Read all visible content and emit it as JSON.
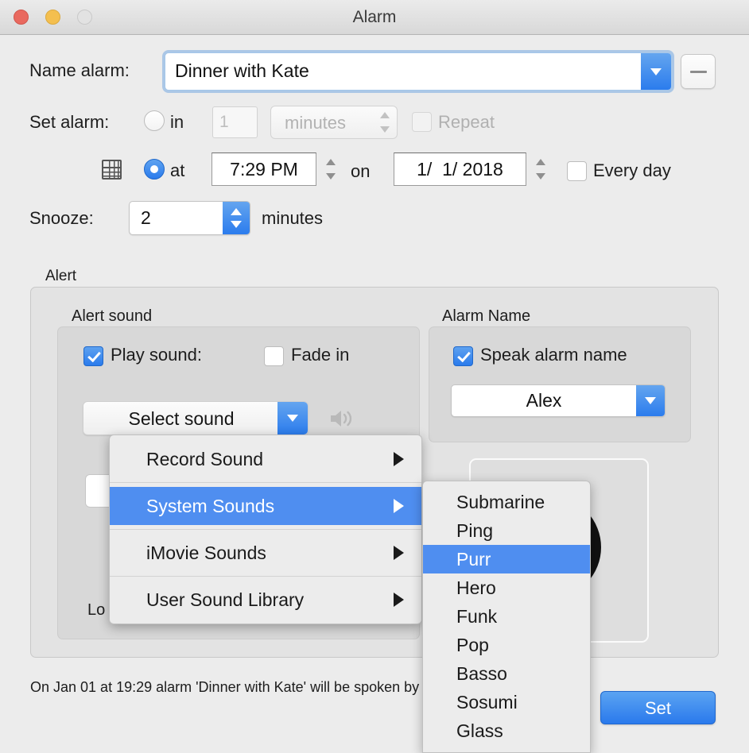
{
  "window": {
    "title": "Alarm",
    "traffic_lights": [
      "close",
      "minimize",
      "zoom"
    ]
  },
  "name_row": {
    "label": "Name alarm:",
    "value": "Dinner with Kate",
    "remove_button": "−"
  },
  "set_alarm": {
    "label": "Set alarm:",
    "in_option": {
      "label": "in",
      "selected": false,
      "amount": "1",
      "unit": "minutes",
      "repeat_label": "Repeat",
      "repeat_checked": false
    },
    "at_option": {
      "label": "at",
      "selected": true,
      "time": "7:29 PM",
      "on_label": "on",
      "date": "1/  1/ 2018",
      "every_day_label": "Every day",
      "every_day_checked": false
    }
  },
  "snooze": {
    "label": "Snooze:",
    "value": "2",
    "unit": "minutes"
  },
  "alert": {
    "legend": "Alert",
    "alert_sound": {
      "legend": "Alert sound",
      "play_sound_label": "Play sound:",
      "play_sound_checked": true,
      "fade_in_label": "Fade in",
      "fade_in_checked": false,
      "select_sound_label": "Select sound",
      "loop_label": "Lo"
    },
    "alarm_name": {
      "legend": "Alarm Name",
      "speak_label": "Speak alarm name",
      "speak_checked": true,
      "voice": "Alex"
    }
  },
  "sound_menu": {
    "items": [
      {
        "label": "Record Sound",
        "selected": false,
        "has_submenu": true
      },
      {
        "label": "System Sounds",
        "selected": true,
        "has_submenu": true
      },
      {
        "label": "iMovie Sounds",
        "selected": false,
        "has_submenu": true
      },
      {
        "label": "User Sound Library",
        "selected": false,
        "has_submenu": true
      }
    ]
  },
  "system_sounds_submenu": {
    "items": [
      {
        "label": "Submarine",
        "selected": false
      },
      {
        "label": "Ping",
        "selected": false
      },
      {
        "label": "Purr",
        "selected": true
      },
      {
        "label": "Hero",
        "selected": false
      },
      {
        "label": "Funk",
        "selected": false
      },
      {
        "label": "Pop",
        "selected": false
      },
      {
        "label": "Basso",
        "selected": false
      },
      {
        "label": "Sosumi",
        "selected": false
      },
      {
        "label": "Glass",
        "selected": false
      }
    ]
  },
  "footer": {
    "status": "On Jan 01 at 19:29 alarm 'Dinner with Kate' will be spoken by voice 'Alex'.",
    "set_button": "Set"
  },
  "colors": {
    "accent": "#2a7bec",
    "menu_highlight": "#4f8ef0",
    "window_bg": "#ececec",
    "group_bg": "#d8d8d8"
  }
}
